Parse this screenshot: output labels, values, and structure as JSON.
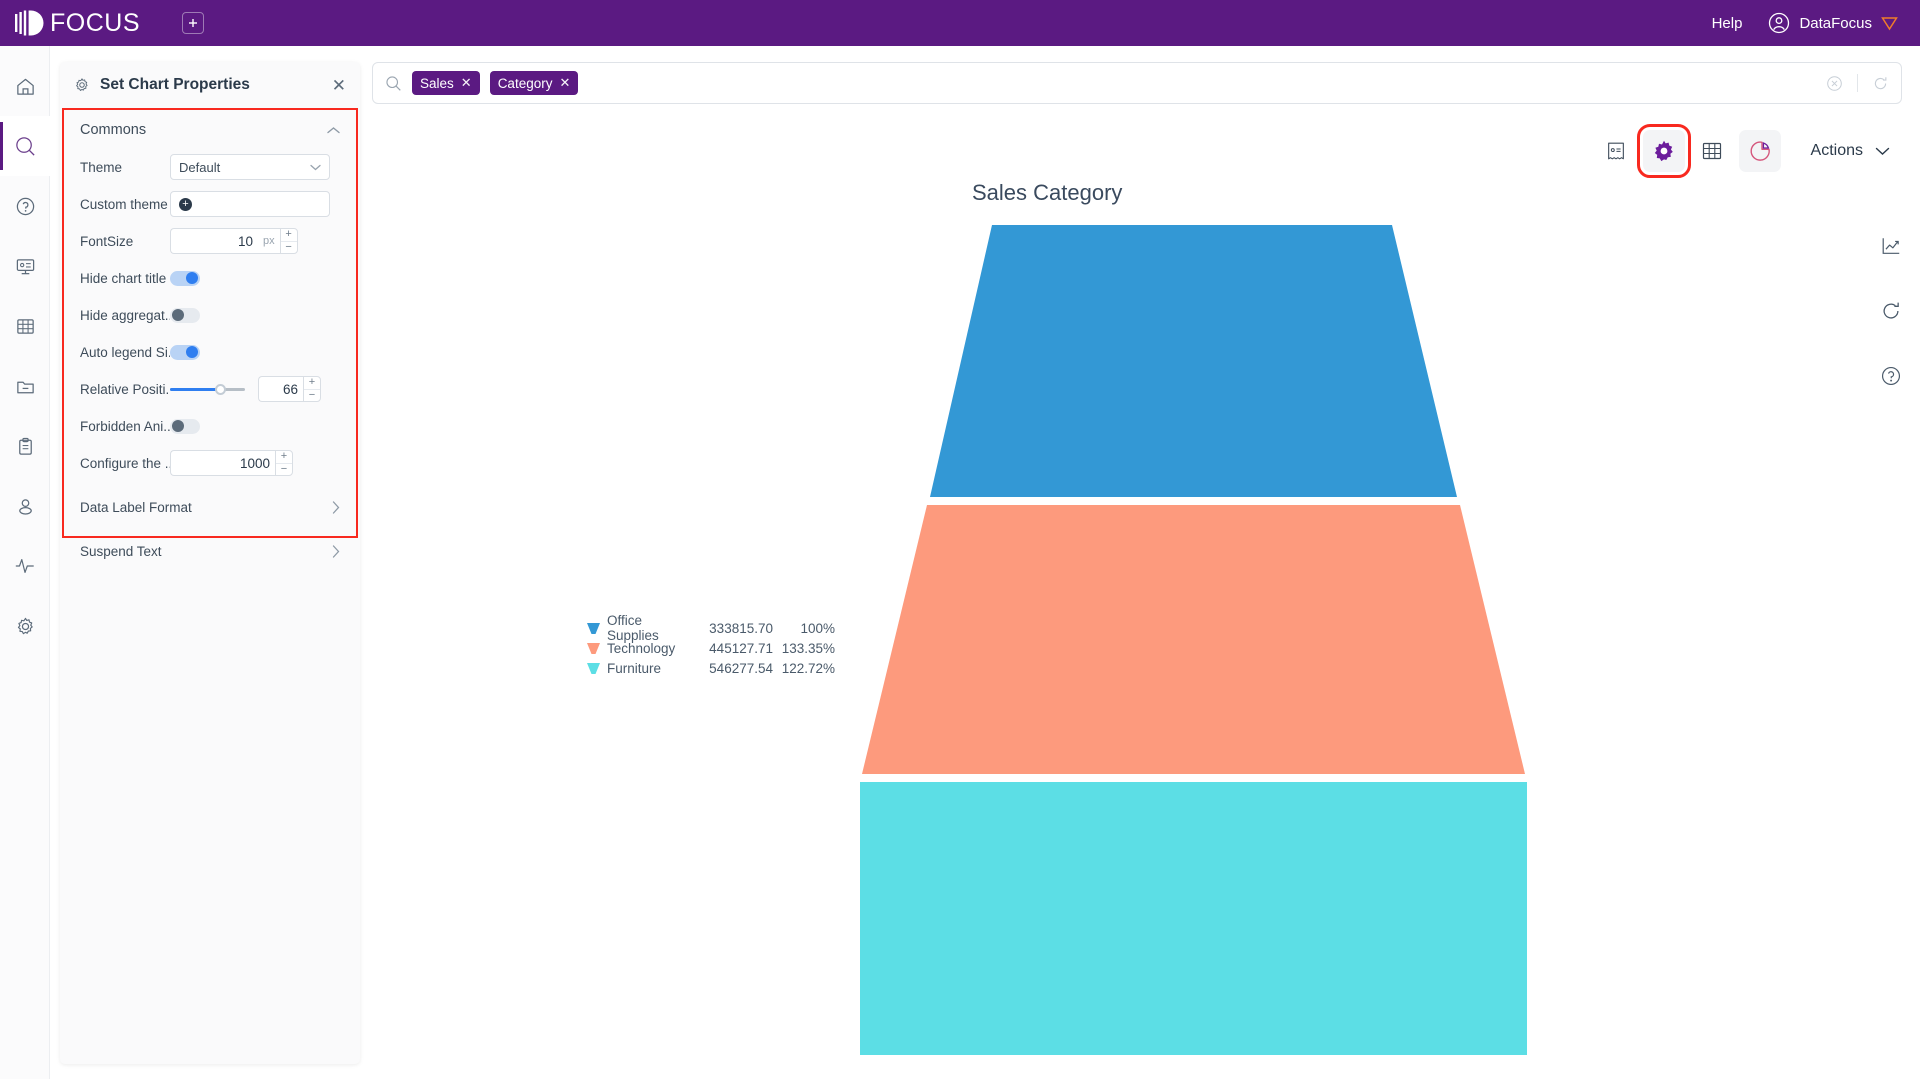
{
  "topbar": {
    "brand": "FOCUS",
    "add_tab_icon": "plus-square-icon",
    "help_label": "Help",
    "user_name": "DataFocus",
    "user_icon": "user-circle-icon",
    "brand_color": "#5b1a82"
  },
  "rail": {
    "items": [
      {
        "icon": "home-icon",
        "active": false
      },
      {
        "icon": "search-icon",
        "active": true
      },
      {
        "icon": "question-circle-icon",
        "active": false
      },
      {
        "icon": "presentation-icon",
        "active": false
      },
      {
        "icon": "table-grid-icon",
        "active": false
      },
      {
        "icon": "folder-minus-icon",
        "active": false
      },
      {
        "icon": "clipboard-icon",
        "active": false
      },
      {
        "icon": "user-icon",
        "active": false
      },
      {
        "icon": "pulse-icon",
        "active": false
      },
      {
        "icon": "gear-icon",
        "active": false
      }
    ]
  },
  "properties_panel": {
    "title": "Set Chart Properties",
    "gear_icon": "gear-icon",
    "close_icon": "close-icon",
    "section": {
      "label": "Commons",
      "chevron_icon": "chevron-up-icon"
    },
    "rows": [
      {
        "label": "Theme",
        "type": "select",
        "value": "Default"
      },
      {
        "label": "Custom theme",
        "type": "add",
        "value": ""
      },
      {
        "label": "FontSize",
        "type": "stepper",
        "value": "10",
        "unit": "px"
      },
      {
        "label": "Hide chart title",
        "type": "toggle",
        "state": "on"
      },
      {
        "label": "Hide aggregat...",
        "type": "toggle",
        "state": "off"
      },
      {
        "label": "Auto legend Si...",
        "type": "toggle",
        "state": "on"
      },
      {
        "label": "Relative Positi...",
        "type": "slider",
        "value": "66",
        "percent": 66
      },
      {
        "label": "Forbidden Ani...",
        "type": "toggle",
        "state": "off"
      },
      {
        "label": "Configure the ...",
        "type": "stepper",
        "value": "1000",
        "unit": ""
      }
    ],
    "sub_sections": [
      {
        "label": "Data Label Format",
        "chevron_icon": "chevron-right-icon"
      },
      {
        "label": "Suspend Text",
        "chevron_icon": "chevron-right-icon"
      }
    ],
    "highlight_color": "#f8291f"
  },
  "search": {
    "search_icon": "search-icon",
    "chips": [
      {
        "label": "Sales",
        "close_icon": "close-icon"
      },
      {
        "label": "Category",
        "close_icon": "close-icon"
      }
    ],
    "clear_icon": "clear-circle-icon",
    "refresh_icon": "refresh-icon"
  },
  "chart_toolbar": {
    "buttons": [
      {
        "name": "receipt-icon",
        "state": "plain"
      },
      {
        "name": "gear-icon",
        "state": "highlighted"
      },
      {
        "name": "table-grid-icon",
        "state": "plain"
      },
      {
        "name": "pie-chart-icon",
        "state": "filled"
      }
    ],
    "actions_label": "Actions",
    "actions_chevron_icon": "chevron-down-icon"
  },
  "right_rail": {
    "items": [
      {
        "icon": "line-chart-icon"
      },
      {
        "icon": "refresh-icon"
      },
      {
        "icon": "question-circle-icon"
      }
    ]
  },
  "chart_data": {
    "type": "funnel",
    "title": "Sales Category",
    "categories": [
      "Office Supplies",
      "Technology",
      "Furniture"
    ],
    "values": [
      333815.7,
      445127.71,
      546277.54
    ],
    "value_labels": [
      "333815.70",
      "445127.71",
      "546277.54"
    ],
    "percent_labels": [
      "100%",
      "133.35%",
      "122.72%"
    ],
    "colors": [
      "#3398d5",
      "#fd9a7d",
      "#5cdee5"
    ],
    "orientation": "inverted",
    "legend_position": "left",
    "xlabel": "",
    "ylabel": ""
  }
}
